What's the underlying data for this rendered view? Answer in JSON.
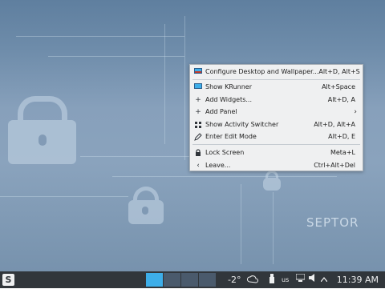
{
  "desktop": {
    "brand_text": "SEPTOR",
    "wallpaper_colors": {
      "base": "#7893ae",
      "pattern": "#bdcfe0"
    }
  },
  "context_menu": {
    "items": [
      {
        "label": "Configure Desktop and Wallpaper...",
        "shortcut": "Alt+D, Alt+S",
        "icon": "configure-desktop-icon"
      },
      {
        "label": "Show KRunner",
        "shortcut": "Alt+Space",
        "icon": "krunner-icon"
      },
      {
        "label": "Add Widgets...",
        "shortcut": "Alt+D, A",
        "icon": "plus-icon"
      },
      {
        "label": "Add Panel",
        "shortcut": "",
        "icon": "plus-icon",
        "submenu": true
      },
      {
        "label": "Show Activity Switcher",
        "shortcut": "Alt+D, Alt+A",
        "icon": "activities-icon"
      },
      {
        "label": "Enter Edit Mode",
        "shortcut": "Alt+D, E",
        "icon": "pencil-icon"
      },
      {
        "label": "Lock Screen",
        "shortcut": "Meta+L",
        "icon": "lock-icon"
      },
      {
        "label": "Leave...",
        "shortcut": "Ctrl+Alt+Del",
        "icon": "chevron-left-icon"
      }
    ]
  },
  "panel": {
    "start_label": "S",
    "temperature": "-2°",
    "keyboard_layout": "us",
    "clock": "11:39 AM",
    "accent_color": "#3daee9",
    "background_color": "#31363b"
  }
}
